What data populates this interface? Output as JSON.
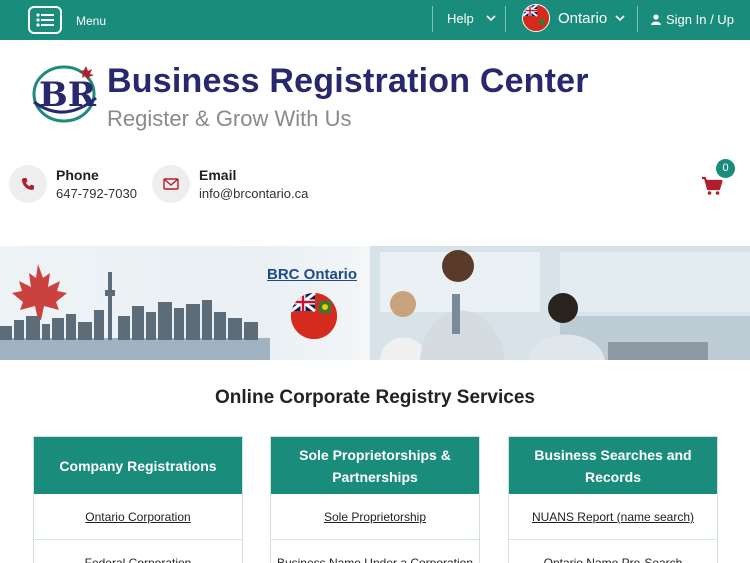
{
  "topbar": {
    "menu_label": "Menu",
    "help_label": "Help",
    "province_label": "Ontario",
    "signin_label": "Sign In / Up"
  },
  "brand": {
    "logo_text": "BR",
    "title": "Business Registration Center",
    "subtitle": "Register & Grow With Us"
  },
  "contact": {
    "phone_title": "Phone",
    "phone_value": "647-792-7030",
    "email_title": "Email",
    "email_value": "info@brcontario.ca"
  },
  "cart": {
    "count": "0"
  },
  "banner": {
    "title": "BRC Ontario"
  },
  "services": {
    "title": "Online Corporate Registry Services",
    "cards": [
      {
        "heading": "Company Registrations",
        "links": [
          "Ontario Corporation",
          "Federal Corporation"
        ]
      },
      {
        "heading": "Sole Proprietorships & Partnerships",
        "links": [
          "Sole Proprietorship",
          "Business Name Under a Corporation"
        ]
      },
      {
        "heading": "Business Searches and Records",
        "links": [
          "NUANS Report (name search)",
          "Ontario Name Pre-Search"
        ]
      }
    ]
  },
  "colors": {
    "primary": "#1a8c7c",
    "brand_navy": "#28286e",
    "accent_red": "#b11f2e"
  }
}
